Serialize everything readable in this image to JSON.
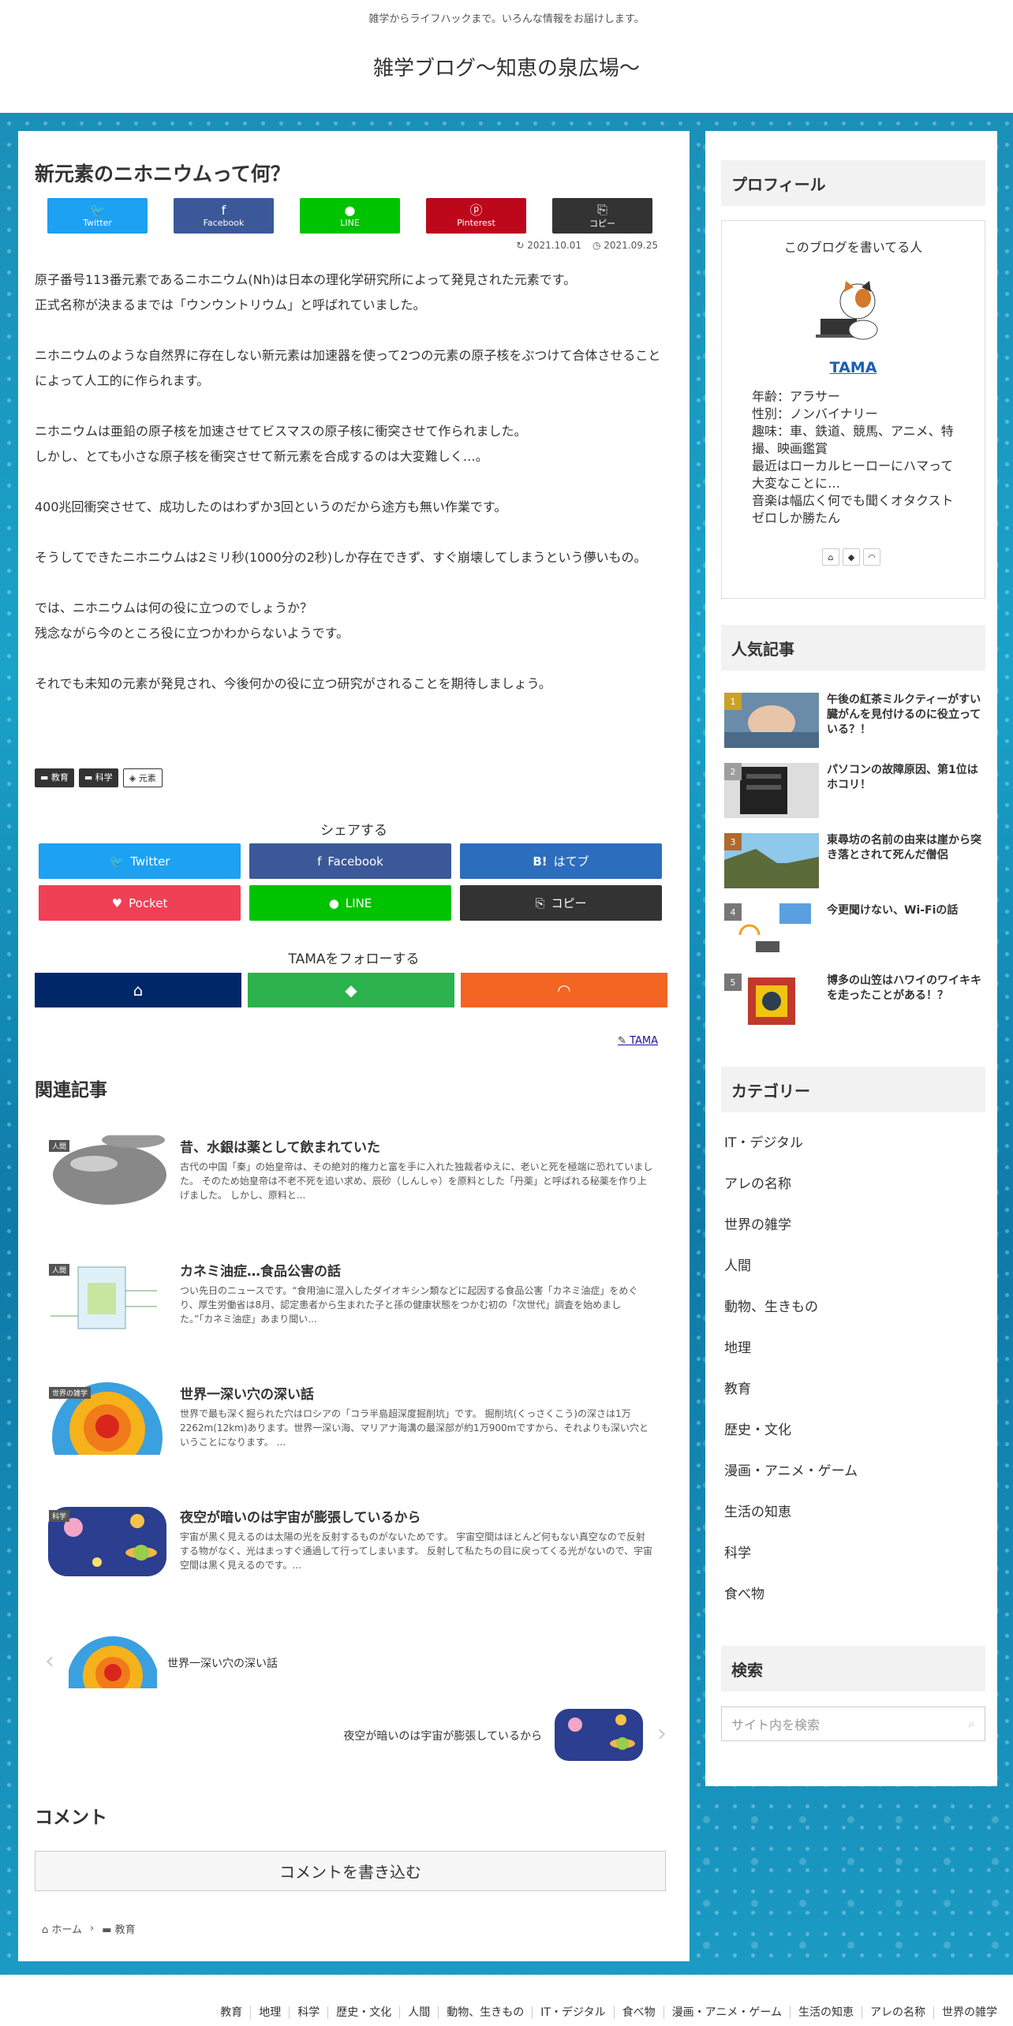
{
  "header": {
    "tagline": "雑学からライフハックまで。いろんな情報をお届けします。",
    "site_title": "雑学ブログ～知恵の泉広場～"
  },
  "article": {
    "title": "新元素のニホニウムって何？",
    "sns_top": [
      {
        "label": "Twitter",
        "color": "#1da1f2",
        "icon": "twitter-icon"
      },
      {
        "label": "Facebook",
        "color": "#3b5998",
        "icon": "facebook-icon"
      },
      {
        "label": "LINE",
        "color": "#00c300",
        "icon": "line-icon"
      },
      {
        "label": "Pinterest",
        "color": "#bd081c",
        "icon": "pinterest-icon"
      },
      {
        "label": "コピー",
        "color": "#333333",
        "icon": "copy-icon"
      }
    ],
    "date_updated": "2021.10.01",
    "date_published": "2021.09.25",
    "paragraphs": [
      [
        "原子番号113番元素であるニホニウム(Nh)は日本の理化学研究所によって発見された元素です。",
        "正式名称が決まるまでは「ウンウントリウム」と呼ばれていました。"
      ],
      [
        "ニホニウムのような自然界に存在しない新元素は加速器を使って2つの元素の原子核をぶつけて合体させることによって人工的に作られます。"
      ],
      [
        "ニホニウムは亜鉛の原子核を加速させてビスマスの原子核に衝突させて作られました。",
        "しかし、とても小さな原子核を衝突させて新元素を合成するのは大変難しく…。"
      ],
      [
        "400兆回衝突させて、成功したのはわずか3回というのだから途方も無い作業です。"
      ],
      [
        "そうしてできたニホニウムは2ミリ秒(1000分の2秒)しか存在できず、すぐ崩壊してしまうという儚いもの。"
      ],
      [
        "では、ニホニウムは何の役に立つのでしょうか？",
        "残念ながら今のところ役に立つかわからないようです。"
      ],
      [
        "それでも未知の元素が発見され、今後何かの役に立つ研究がされることを期待しましょう。"
      ]
    ],
    "tags": [
      {
        "label": "教育",
        "type": "category"
      },
      {
        "label": "科学",
        "type": "category"
      },
      {
        "label": "元素",
        "type": "tag"
      }
    ],
    "share_title": "シェアする",
    "share_buttons": [
      {
        "label": "Twitter",
        "color": "#1da1f2",
        "icon": "twitter-icon"
      },
      {
        "label": "Facebook",
        "color": "#3b5998",
        "icon": "facebook-icon"
      },
      {
        "label": "はてブ",
        "color": "#2c6ebd",
        "icon": "hatena-icon"
      },
      {
        "label": "Pocket",
        "color": "#ef4056",
        "icon": "pocket-icon"
      },
      {
        "label": "LINE",
        "color": "#00c300",
        "icon": "line-icon"
      },
      {
        "label": "コピー",
        "color": "#333333",
        "icon": "copy-icon"
      }
    ],
    "follow_title": "TAMAをフォローする",
    "follow_buttons": [
      {
        "icon": "home-icon",
        "color": "#002868"
      },
      {
        "icon": "feedly-icon",
        "color": "#2bb24c"
      },
      {
        "icon": "rss-icon",
        "color": "#f26522"
      }
    ],
    "author": "TAMA"
  },
  "related": {
    "heading": "関連記事",
    "items": [
      {
        "category": "人間",
        "title": "昔、水銀は薬として飲まれていた",
        "excerpt": "古代の中国「秦」の始皇帝は、その絶対的権力と富を手に入れた独裁者ゆえに、老いと死を極端に恐れていました。 そのため始皇帝は不老不死を追い求め、辰砂（しんしゃ）を原料とした「丹薬」と呼ばれる秘薬を作り上げました。 しかし、原料と..."
      },
      {
        "category": "人間",
        "title": "カネミ油症…食品公害の話",
        "excerpt": "つい先日のニュースです。“食用油に混入したダイオキシン類などに起因する食品公害「カネミ油症」をめぐり、厚生労働省は8月、認定患者から生まれた子と孫の健康状態をつかむ初の「次世代」調査を始めました。”「カネミ油症」あまり聞い..."
      },
      {
        "category": "世界の雑学",
        "title": "世界一深い穴の深い話",
        "excerpt": "世界で最も深く掘られた穴はロシアの「コラ半島超深度掘削坑」です。 掘削坑(くっさくこう)の深さは1万2262m(12km)あります。世界一深い海、マリアナ海溝の最深部が約1万900mですから、それよりも深い穴ということになります。 ..."
      },
      {
        "category": "科学",
        "title": "夜空が暗いのは宇宙が膨張しているから",
        "excerpt": "宇宙が黒く見えるのは太陽の光を反射するものがないためです。 宇宙空間はほとんど何もない真空なので反射する物がなく、光はまっすぐ通過して行ってしまいます。 反射して私たちの目に戻ってくる光がないので、宇宙空間は黒く見えるのです。..."
      }
    ],
    "prev": "世界一深い穴の深い話",
    "next": "夜空が暗いのは宇宙が膨張しているから"
  },
  "comments": {
    "heading": "コメント",
    "button": "コメントを書き込む"
  },
  "breadcrumb": {
    "home": "ホーム",
    "category": "教育"
  },
  "sidebar": {
    "profile": {
      "heading": "プロフィール",
      "intro": "このブログを書いてる人",
      "name": "TAMA",
      "lines": [
        "年齢：アラサー",
        "性別：ノンバイナリー",
        "趣味：車、鉄道、競馬、アニメ、特撮、映画鑑賞",
        "最近はローカルヒーローにハマって大変なことに…",
        "音楽は幅広く何でも聞くオタクストゼロしか勝たん"
      ]
    },
    "popular": {
      "heading": "人気記事",
      "items": [
        {
          "rank": "1",
          "title": "午後の紅茶ミルクティーがすい臓がんを見付けるのに役立っている？！",
          "rank_color": "#c9a227"
        },
        {
          "rank": "2",
          "title": "パソコンの故障原因、第1位はホコリ！",
          "rank_color": "#9e9e9e"
        },
        {
          "rank": "3",
          "title": "東尋坊の名前の由来は崖から突き落とされて死んだ僧侶",
          "rank_color": "#b06a2e"
        },
        {
          "rank": "4",
          "title": "今更聞けない、Wi-Fiの話",
          "rank_color": "#777777"
        },
        {
          "rank": "5",
          "title": "博多の山笠はハワイのワイキキを走ったことがある！？",
          "rank_color": "#777777"
        }
      ]
    },
    "categories": {
      "heading": "カテゴリー",
      "items": [
        "IT・デジタル",
        "アレの名称",
        "世界の雑学",
        "人間",
        "動物、生きもの",
        "地理",
        "教育",
        "歴史・文化",
        "漫画・アニメ・ゲーム",
        "生活の知恵",
        "科学",
        "食べ物"
      ]
    },
    "search": {
      "heading": "検索",
      "placeholder": "サイト内を検索"
    }
  },
  "footer": {
    "links": [
      "教育",
      "地理",
      "科学",
      "歴史・文化",
      "人間",
      "動物、生きもの",
      "IT・デジタル",
      "食べ物",
      "漫画・アニメ・ゲーム",
      "生活の知恵",
      "アレの名称",
      "世界の雑学"
    ]
  }
}
